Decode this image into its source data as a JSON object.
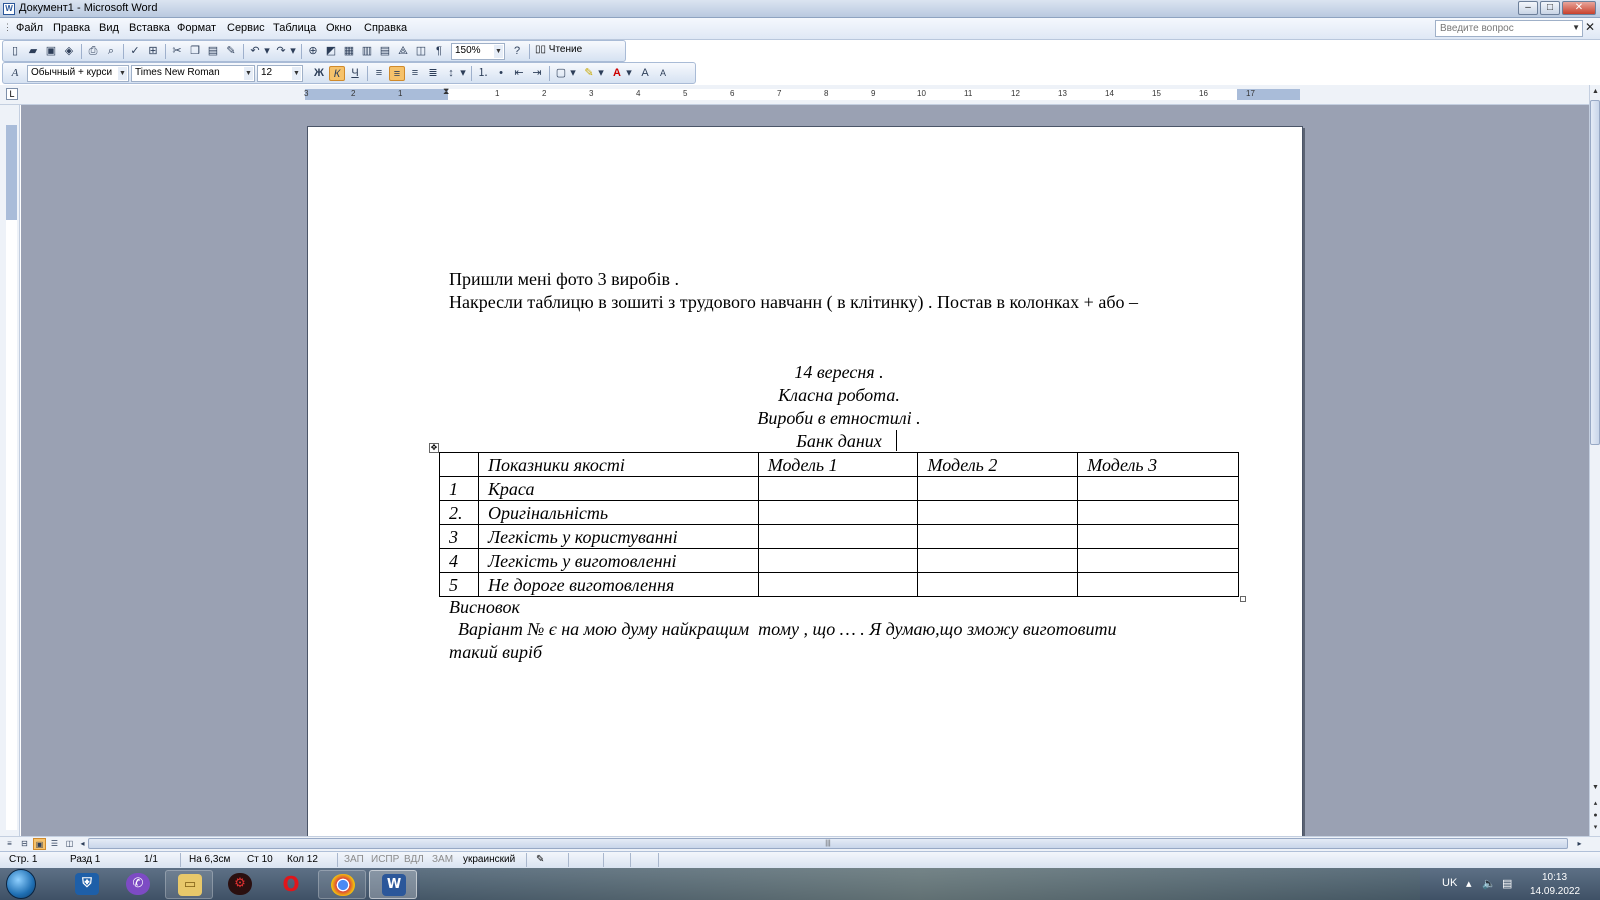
{
  "window": {
    "title": "Документ1 - Microsoft Word",
    "controls": {
      "minimize": "–",
      "maximize": "□",
      "close": "✕"
    }
  },
  "menu": {
    "items": [
      "Файл",
      "Правка",
      "Вид",
      "Вставка",
      "Формат",
      "Сервис",
      "Таблица",
      "Окно",
      "Справка"
    ],
    "help_placeholder": "Введите вопрос",
    "close_glyph": "✕"
  },
  "standard_toolbar": {
    "zoom": "150%",
    "read_label": "Чтение"
  },
  "format_toolbar": {
    "style": "Обычный + курси",
    "font": "Times New Roman",
    "size": "12",
    "bold": "Ж",
    "italic": "К",
    "underline": "Ч"
  },
  "ruler": {
    "numbers": [
      "3",
      "2",
      "1",
      "1",
      "2",
      "3",
      "4",
      "5",
      "6",
      "7",
      "8",
      "9",
      "10",
      "11",
      "12",
      "13",
      "14",
      "15",
      "16",
      "17"
    ]
  },
  "document": {
    "line1": "Пришли мені фото 3  виробів .",
    "line2": "Накресли  таблицю в зошиті з трудового навчанн ( в клітинку) . Постав в колонках + або –",
    "date": "14 вересня .",
    "class_work": "Класна робота.",
    "topic": "Вироби в етностилі .",
    "bank": "Банк даних ",
    "table": {
      "header": [
        "",
        "Показники якості",
        "Модель 1",
        "Модель 2",
        "Модель 3"
      ],
      "rows": [
        [
          "1",
          "Краса",
          "",
          "",
          ""
        ],
        [
          "2.",
          "Оригінальність",
          "",
          "",
          ""
        ],
        [
          "3",
          "Легкість у користуванні",
          "",
          "",
          ""
        ],
        [
          "4",
          "Легкість у виготовленні",
          "",
          "",
          ""
        ],
        [
          "5",
          "Не дороге виготовлення",
          "",
          "",
          ""
        ]
      ]
    },
    "conclusion_title": "Висновок",
    "conclusion_line1": "  Варіант № є на мою думу найкращим  тому , що … . Я думаю,що зможу виготовити",
    "conclusion_line2": "такий виріб"
  },
  "statusbar": {
    "page": "Стр. 1",
    "section": "Разд 1",
    "pages": "1/1",
    "at": "На 6,3см",
    "line": "Ст 10",
    "col": "Кол 12",
    "rec": "ЗАП",
    "trk": "ИСПР",
    "ext": "ВДЛ",
    "ovr": "ЗАМ",
    "language": "украинский"
  },
  "taskbar": {
    "lang": "UK",
    "time": "10:13",
    "date": "14.09.2022"
  }
}
